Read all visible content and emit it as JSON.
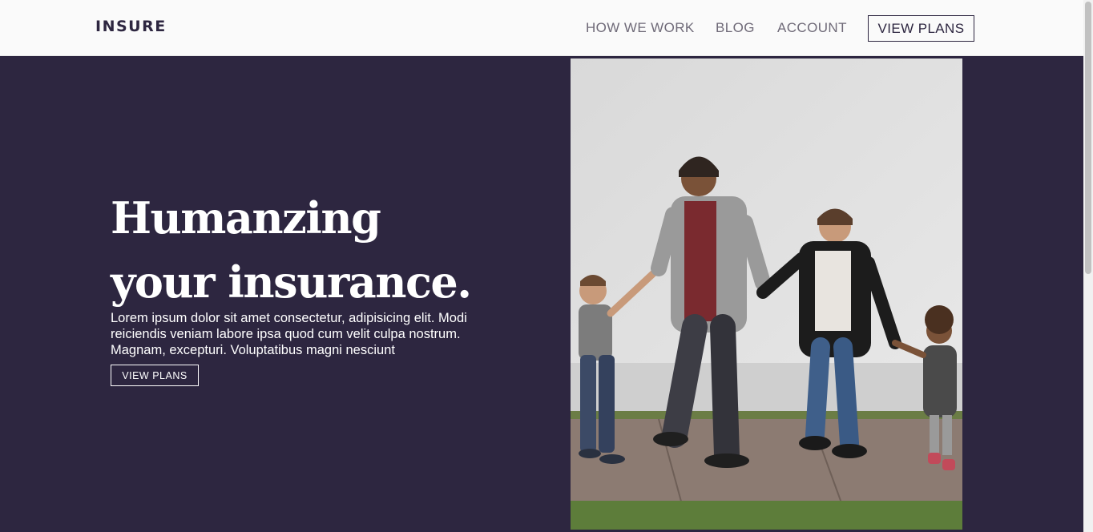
{
  "header": {
    "logo": "INSURE",
    "nav": [
      "HOW WE WORK",
      "BLOG",
      "ACCOUNT"
    ],
    "cta": "VIEW PLANS"
  },
  "hero": {
    "title": "Humanzing your insurance.",
    "description": "Lorem ipsum dolor sit amet consectetur, adipisicing elit. Modi reiciendis veniam labore ipsa quod cum velit culpa nostrum. Magnam, excepturi. Voluptatibus magni nesciunt",
    "cta": "VIEW PLANS"
  },
  "colors": {
    "header_bg": "#fafafa",
    "hero_bg": "#2d2640",
    "nav_text": "#6f6a78",
    "brand": "#2d2640"
  }
}
